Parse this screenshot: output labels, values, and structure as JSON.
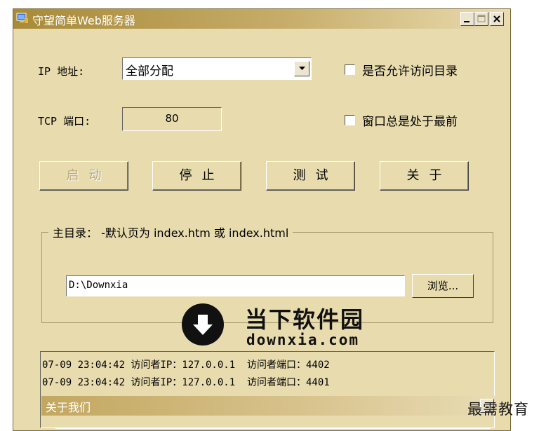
{
  "window": {
    "title": "守望简单Web服务器",
    "controls": {
      "minimize": "minimize",
      "maximize": "maximize",
      "close": "close"
    }
  },
  "ip": {
    "label": "IP 地址:",
    "value": "全部分配"
  },
  "tcp": {
    "label": "TCP 端口:",
    "value": "80"
  },
  "options": {
    "allow_dir": "是否允许访问目录",
    "always_on_top": "窗口总是处于最前"
  },
  "buttons": {
    "start": "启动",
    "stop": "停止",
    "test": "测试",
    "about": "关于"
  },
  "home": {
    "group_title": "主目录： -默认页为 index.htm 或 index.html",
    "path": "D:\\Downxia",
    "browse": "浏览..."
  },
  "watermark": {
    "cn": "当下软件园",
    "en": "downxia.com"
  },
  "log": [
    "07-09 23:04:42 访问者IP：127.0.0.1  访问者端口：4402",
    "07-09 23:04:42 访问者IP：127.0.0.1  访问者端口：4401"
  ],
  "about_dialog": {
    "title": "关于我们"
  },
  "corner_watermark": "最需教育",
  "colors": {
    "window_bg": "#e8dcaf",
    "title_start": "#a88a38",
    "title_end": "#eadcb0"
  }
}
